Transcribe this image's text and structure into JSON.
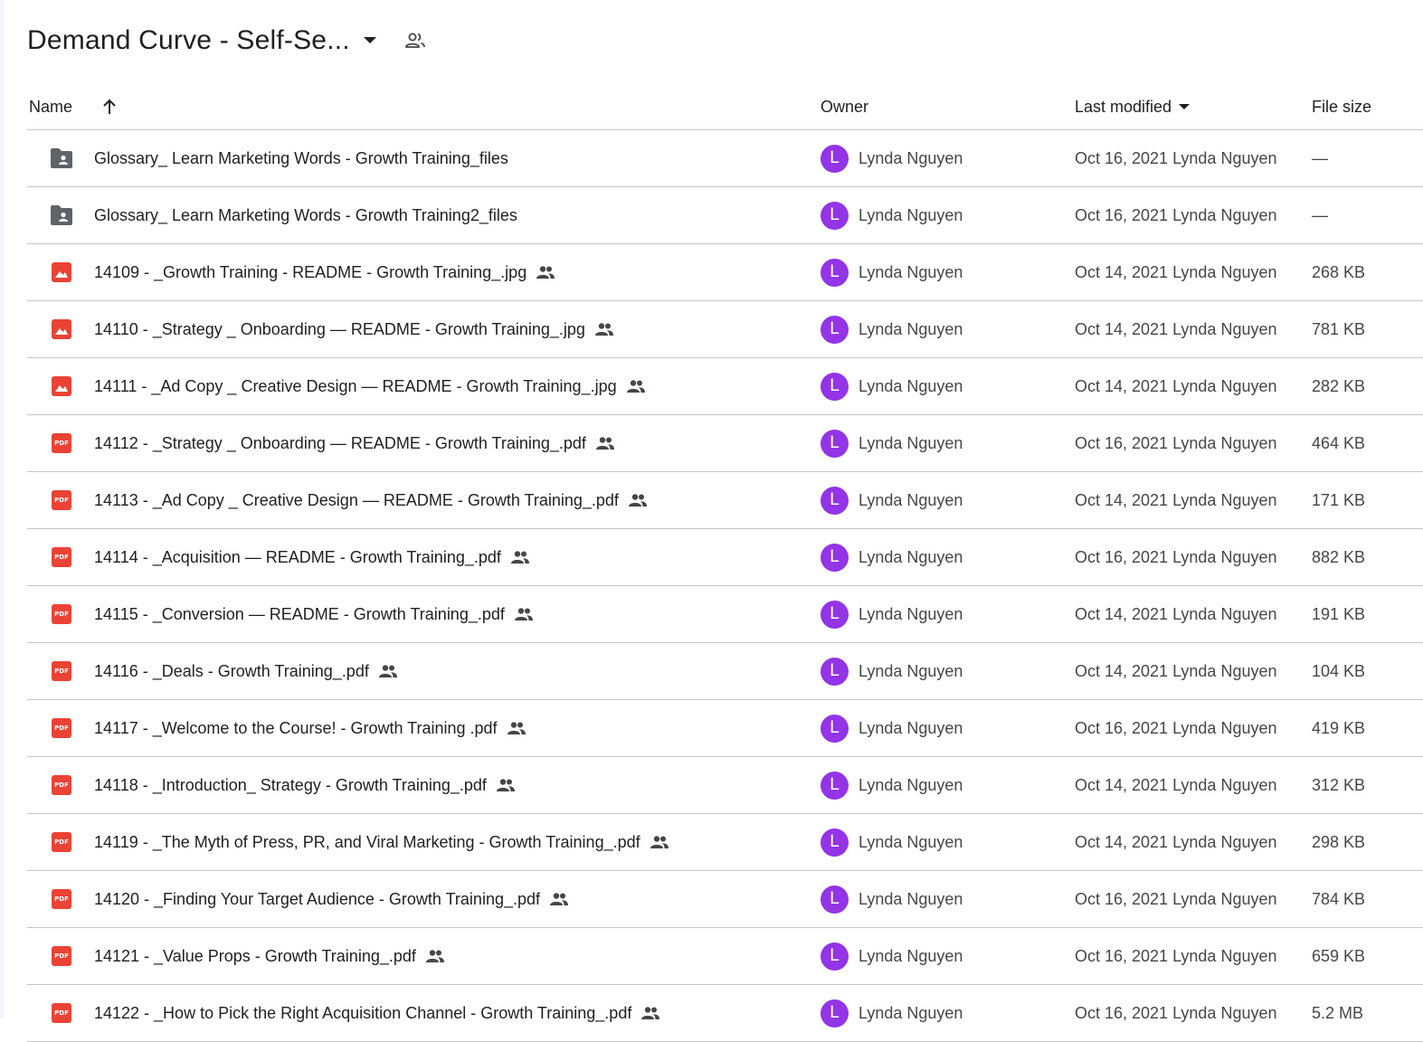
{
  "header": {
    "folder_title": "Demand Curve - Self-Se...",
    "dropdown_icon": "arrow-drop-down-icon",
    "shared_icon": "people-outline-icon"
  },
  "columns": {
    "name": "Name",
    "sort_icon": "arrow-up-icon",
    "owner": "Owner",
    "last_modified": "Last modified",
    "last_modified_icon": "arrow-drop-down-icon",
    "file_size": "File size"
  },
  "colors": {
    "pdf": "#ea4335",
    "image": "#ea4335",
    "folder": "#5f6368",
    "avatar": "#9334e6"
  },
  "rows": [
    {
      "type": "shared-folder",
      "name": "Glossary_ Learn Marketing Words - Growth Training_files",
      "shared": false,
      "owner": "Lynda Nguyen",
      "avatar_initial": "L",
      "modified": "Oct 16, 2021 Lynda Nguyen",
      "size": "—"
    },
    {
      "type": "shared-folder",
      "name": "Glossary_ Learn Marketing Words - Growth Training2_files",
      "shared": false,
      "owner": "Lynda Nguyen",
      "avatar_initial": "L",
      "modified": "Oct 16, 2021 Lynda Nguyen",
      "size": "—"
    },
    {
      "type": "image",
      "name": "14109 - _Growth Training - README - Growth Training_.jpg",
      "shared": true,
      "owner": "Lynda Nguyen",
      "avatar_initial": "L",
      "modified": "Oct 14, 2021 Lynda Nguyen",
      "size": "268 KB"
    },
    {
      "type": "image",
      "name": "14110 - _Strategy _ Onboarding — README - Growth Training_.jpg",
      "shared": true,
      "owner": "Lynda Nguyen",
      "avatar_initial": "L",
      "modified": "Oct 14, 2021 Lynda Nguyen",
      "size": "781 KB"
    },
    {
      "type": "image",
      "name": "14111 - _Ad Copy _ Creative Design — README - Growth Training_.jpg",
      "shared": true,
      "owner": "Lynda Nguyen",
      "avatar_initial": "L",
      "modified": "Oct 14, 2021 Lynda Nguyen",
      "size": "282 KB"
    },
    {
      "type": "pdf",
      "name": "14112 - _Strategy _ Onboarding — README - Growth Training_.pdf",
      "shared": true,
      "owner": "Lynda Nguyen",
      "avatar_initial": "L",
      "modified": "Oct 16, 2021 Lynda Nguyen",
      "size": "464 KB"
    },
    {
      "type": "pdf",
      "name": "14113 - _Ad Copy _ Creative Design — README - Growth Training_.pdf",
      "shared": true,
      "owner": "Lynda Nguyen",
      "avatar_initial": "L",
      "modified": "Oct 14, 2021 Lynda Nguyen",
      "size": "171 KB"
    },
    {
      "type": "pdf",
      "name": "14114 - _Acquisition — README - Growth Training_.pdf",
      "shared": true,
      "owner": "Lynda Nguyen",
      "avatar_initial": "L",
      "modified": "Oct 16, 2021 Lynda Nguyen",
      "size": "882 KB"
    },
    {
      "type": "pdf",
      "name": "14115 - _Conversion — README - Growth Training_.pdf",
      "shared": true,
      "owner": "Lynda Nguyen",
      "avatar_initial": "L",
      "modified": "Oct 14, 2021 Lynda Nguyen",
      "size": "191 KB"
    },
    {
      "type": "pdf",
      "name": "14116 - _Deals - Growth Training_.pdf",
      "shared": true,
      "owner": "Lynda Nguyen",
      "avatar_initial": "L",
      "modified": "Oct 14, 2021 Lynda Nguyen",
      "size": "104 KB"
    },
    {
      "type": "pdf",
      "name": "14117 - _Welcome to the Course! - Growth Training  .pdf",
      "shared": true,
      "owner": "Lynda Nguyen",
      "avatar_initial": "L",
      "modified": "Oct 16, 2021 Lynda Nguyen",
      "size": "419 KB"
    },
    {
      "type": "pdf",
      "name": "14118 - _Introduction_ Strategy - Growth Training_.pdf",
      "shared": true,
      "owner": "Lynda Nguyen",
      "avatar_initial": "L",
      "modified": "Oct 14, 2021 Lynda Nguyen",
      "size": "312 KB"
    },
    {
      "type": "pdf",
      "name": "14119 - _The Myth of Press, PR, and Viral Marketing - Growth Training_.pdf",
      "shared": true,
      "owner": "Lynda Nguyen",
      "avatar_initial": "L",
      "modified": "Oct 14, 2021 Lynda Nguyen",
      "size": "298 KB"
    },
    {
      "type": "pdf",
      "name": "14120 - _Finding Your Target Audience - Growth Training_.pdf",
      "shared": true,
      "owner": "Lynda Nguyen",
      "avatar_initial": "L",
      "modified": "Oct 16, 2021 Lynda Nguyen",
      "size": "784 KB"
    },
    {
      "type": "pdf",
      "name": "14121 - _Value Props - Growth Training_.pdf",
      "shared": true,
      "owner": "Lynda Nguyen",
      "avatar_initial": "L",
      "modified": "Oct 16, 2021 Lynda Nguyen",
      "size": "659 KB"
    },
    {
      "type": "pdf",
      "name": "14122 - _How to Pick the Right Acquisition Channel - Growth Training_.pdf",
      "shared": true,
      "owner": "Lynda Nguyen",
      "avatar_initial": "L",
      "modified": "Oct 16, 2021 Lynda Nguyen",
      "size": "5.2 MB"
    }
  ]
}
